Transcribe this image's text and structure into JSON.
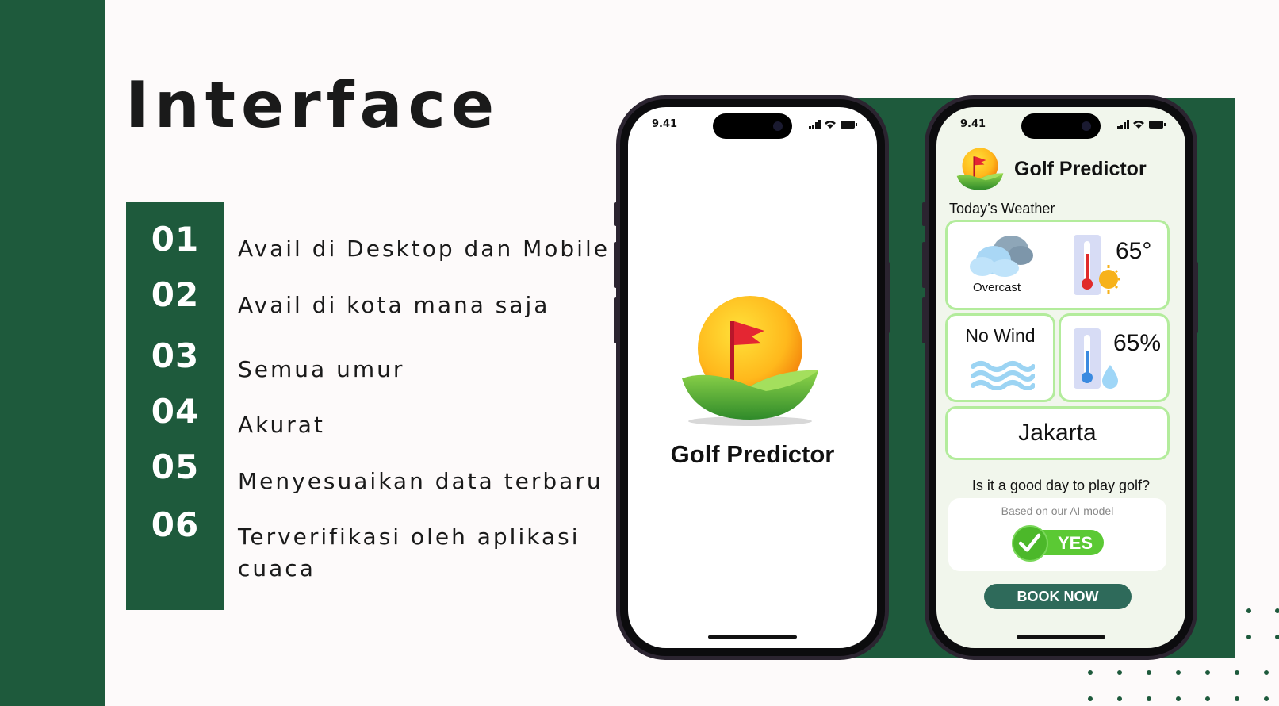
{
  "slide": {
    "title": "Interface",
    "features": [
      {
        "num": "01",
        "text": "Avail di Desktop dan Mobile"
      },
      {
        "num": "02",
        "text": "Avail di kota mana saja"
      },
      {
        "num": "03",
        "text": "Semua umur"
      },
      {
        "num": "04",
        "text": "Akurat"
      },
      {
        "num": "05",
        "text": "Menyesuaikan data terbaru"
      },
      {
        "num": "06",
        "text": "Terverifikasi oleh aplikasi cuaca"
      }
    ]
  },
  "splash_phone": {
    "time": "9.41",
    "app_name": "Golf Predictor"
  },
  "app_phone": {
    "time": "9.41",
    "app_name": "Golf Predictor",
    "weather_label": "Today’s Weather",
    "condition": "Overcast",
    "temperature": "65°",
    "wind": "No Wind",
    "humidity": "65%",
    "city": "Jakarta",
    "question": "Is it a good day to play golf?",
    "model_label": "Based on our AI model",
    "verdict": "YES",
    "book_label": "BOOK NOW"
  },
  "colors": {
    "brand_green": "#1e5a3c",
    "card_border": "#b3ec9c",
    "yes_green": "#5bc934",
    "book_button": "#2e6a5a",
    "app_bg": "#f1f6ec"
  }
}
